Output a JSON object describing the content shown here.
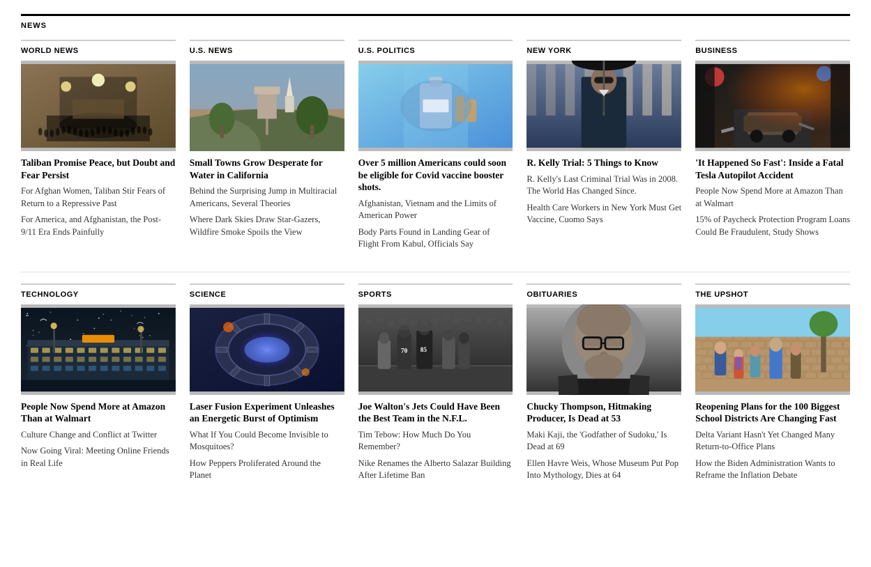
{
  "section": {
    "label": "NEWS"
  },
  "row1": [
    {
      "id": "world-news",
      "category": "World News",
      "imgDesc": "Large gathering in a hall with bright lights",
      "imgColor1": "#8B7355",
      "imgColor2": "#5C4A2A",
      "headline": "Taliban Promise Peace, but Doubt and Fear Persist",
      "stories": [
        "For Afghan Women, Taliban Stir Fears of Return to a Repressive Past",
        "For America, and Afghanistan, the Post-9/11 Era Ends Painfully"
      ]
    },
    {
      "id": "us-news",
      "category": "U.S. News",
      "imgDesc": "Rural landscape with water tower",
      "imgColor1": "#7A8A6E",
      "imgColor2": "#4A5A40",
      "headline": "Small Towns Grow Desperate for Water in California",
      "stories": [
        "Behind the Surprising Jump in Multiracial Americans, Several Theories",
        "Where Dark Skies Draw Star-Gazers, Wildfire Smoke Spoils the View"
      ]
    },
    {
      "id": "us-politics",
      "category": "U.S. Politics",
      "imgDesc": "Medical gloved hand with vaccine",
      "imgColor1": "#87CEEB",
      "imgColor2": "#4A90D9",
      "headline": "Over 5 million Americans could soon be eligible for Covid vaccine booster shots.",
      "stories": [
        "Afghanistan, Vietnam and the Limits of American Power",
        "Body Parts Found in Landing Gear of Flight From Kabul, Officials Say"
      ]
    },
    {
      "id": "new-york",
      "category": "New York",
      "imgDesc": "Man in suit with sunglasses and umbrella",
      "imgColor1": "#4A4A6A",
      "imgColor2": "#2A2A4A",
      "headline": "R. Kelly Trial: 5 Things to Know",
      "stories": [
        "R. Kelly's Last Criminal Trial Was in 2008. The World Has Changed Since.",
        "Health Care Workers in New York Must Get Vaccine, Cuomo Says"
      ]
    },
    {
      "id": "business",
      "category": "Business",
      "imgDesc": "Night scene of car accident with emergency lights",
      "imgColor1": "#3A2A1A",
      "imgColor2": "#6A4A2A",
      "headline": "'It Happened So Fast': Inside a Fatal Tesla Autopilot Accident",
      "stories": [
        "People Now Spend More at Amazon Than at Walmart",
        "15% of Paycheck Protection Program Loans Could Be Fraudulent, Study Shows"
      ]
    }
  ],
  "row2": [
    {
      "id": "technology",
      "category": "Technology",
      "imgDesc": "Amazon warehouse at night",
      "imgColor1": "#1A2A3A",
      "imgColor2": "#0A1A2A",
      "headline": "People Now Spend More at Amazon Than at Walmart",
      "stories": [
        "Culture Change and Conflict at Twitter",
        "Now Going Viral: Meeting Online Friends in Real Life"
      ]
    },
    {
      "id": "science",
      "category": "Science",
      "imgDesc": "Nuclear fusion reactor machinery",
      "imgColor1": "#2A3A5A",
      "imgColor2": "#1A2A4A",
      "headline": "Laser Fusion Experiment Unleashes an Energetic Burst of Optimism",
      "stories": [
        "What If You Could Become Invisible to Mosquitoes?",
        "How Peppers Proliferated Around the Planet"
      ]
    },
    {
      "id": "sports",
      "category": "Sports",
      "imgDesc": "Black and white football game photo",
      "imgColor1": "#5A5A5A",
      "imgColor2": "#3A3A3A",
      "headline": "Joe Walton's Jets Could Have Been the Best Team in the N.F.L.",
      "stories": [
        "Tim Tebow: How Much Do You Remember?",
        "Nike Renames the Alberto Salazar Building After Lifetime Ban"
      ]
    },
    {
      "id": "obituaries",
      "category": "Obituaries",
      "imgDesc": "Black and white portrait of man with glasses",
      "imgColor1": "#3A3A3A",
      "imgColor2": "#1A1A1A",
      "headline": "Chucky Thompson, Hitmaking Producer, Is Dead at 53",
      "stories": [
        "Maki Kaji, the 'Godfather of Sudoku,' Is Dead at 69",
        "Ellen Havre Weis, Whose Museum Put Pop Into Mythology, Dies at 64"
      ]
    },
    {
      "id": "the-upshot",
      "category": "The Upshot",
      "imgDesc": "Students outside a school building",
      "imgColor1": "#6A7A5A",
      "imgColor2": "#4A5A3A",
      "headline": "Reopening Plans for the 100 Biggest School Districts Are Changing Fast",
      "stories": [
        "Delta Variant Hasn't Yet Changed Many Return-to-Office Plans",
        "How the Biden Administration Wants to Reframe the Inflation Debate"
      ]
    }
  ]
}
